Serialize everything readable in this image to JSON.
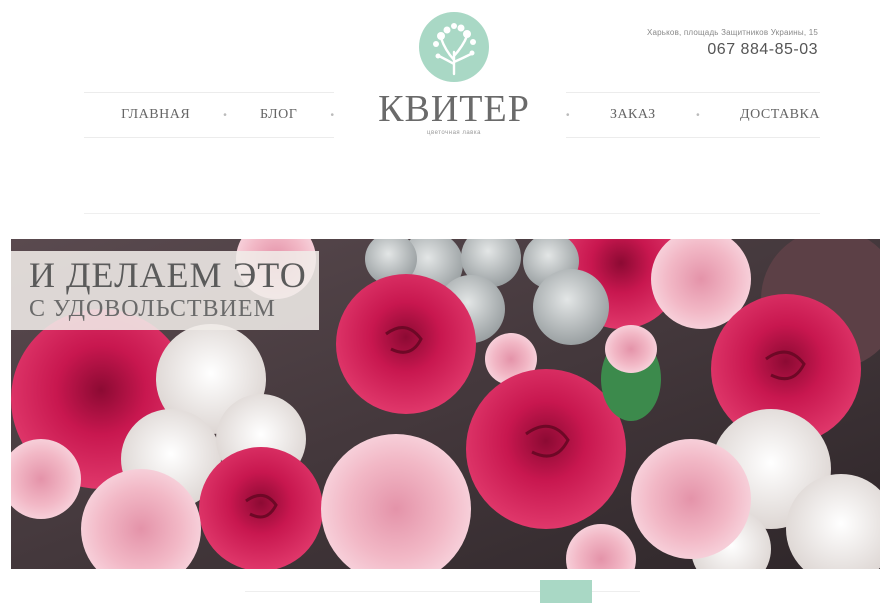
{
  "header": {
    "address": "Харьков, площадь Защитников Украины, 15",
    "phone": "067 884-85-03",
    "logo": {
      "title": "КВИТЕР",
      "subtitle": "цветочная лавка"
    },
    "nav_left": [
      {
        "label": "ГЛАВНАЯ"
      },
      {
        "label": "БЛОГ"
      }
    ],
    "nav_right": [
      {
        "label": "ЗАКАЗ"
      },
      {
        "label": "ДОСТАВКА"
      }
    ]
  },
  "hero": {
    "caption_line1": "И ДЕЛАЕМ ЭТО",
    "caption_line2": "С УДОВОЛЬСТВИЕМ"
  },
  "colors": {
    "accent": "#a9d8c5",
    "rose": "#c8174f",
    "carnation": "#f2b8c6"
  }
}
